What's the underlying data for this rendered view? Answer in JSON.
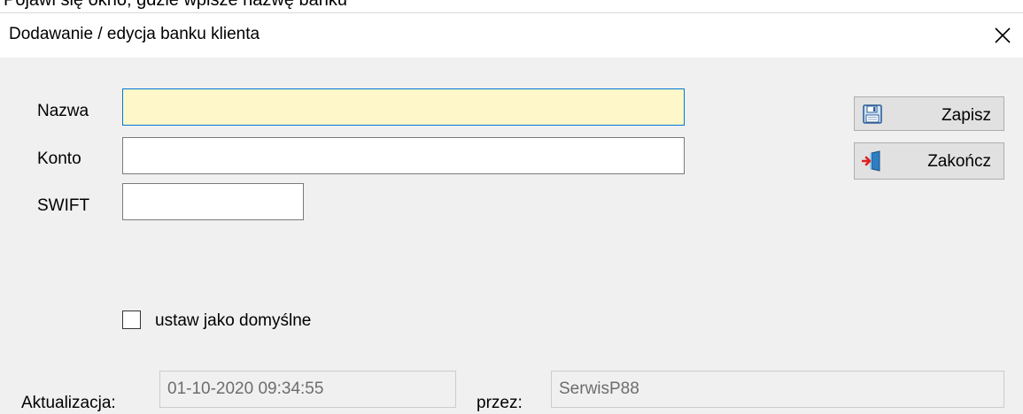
{
  "background_hint": "Pojawi się okno, gdzie wpisze nazwę banku",
  "dialog": {
    "title": "Dodawanie / edycja banku klienta",
    "close_symbol": "✕"
  },
  "form": {
    "name_label": "Nazwa",
    "name_value": "",
    "account_label": "Konto",
    "account_value": "",
    "swift_label": "SWIFT",
    "swift_value": "",
    "default_checkbox_label": "ustaw jako domyślne",
    "default_checked": false
  },
  "buttons": {
    "save_label": "Zapisz",
    "exit_label": "Zakończ"
  },
  "footer": {
    "updated_label": "Aktualizacja:",
    "updated_value": "01-10-2020 09:34:55",
    "by_label": "przez:",
    "by_value": "SerwisP88"
  },
  "colors": {
    "window_bg": "#f0f0f0",
    "focused_field_bg": "#fdf7c9",
    "focus_border": "#0078d7",
    "button_bg": "#e1e1e1"
  },
  "icons": {
    "save": "floppy-disk-icon",
    "exit": "exit-door-icon",
    "close": "close-icon"
  }
}
